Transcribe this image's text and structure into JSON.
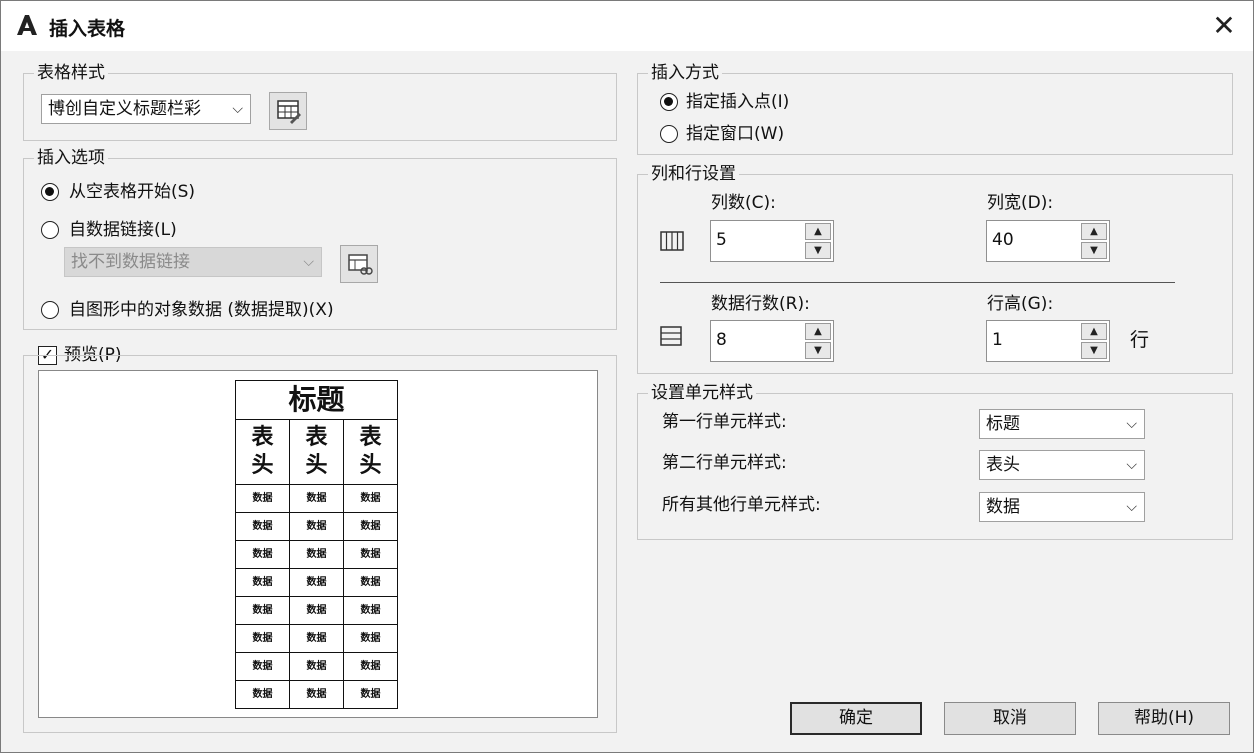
{
  "window": {
    "title": "插入表格",
    "close_glyph": "✕"
  },
  "table_style": {
    "group_label": "表格样式",
    "selected": "博创自定义标题栏彩"
  },
  "insert_options": {
    "group_label": "插入选项",
    "from_empty": "从空表格开始(S)",
    "from_data_link": "自数据链接(L)",
    "data_link_combo": "找不到数据链接",
    "from_object_data": "自图形中的对象数据 (数据提取)(X)",
    "selected": "from_empty"
  },
  "preview": {
    "label": "预览(P)",
    "checked": true,
    "title": "标题",
    "header_cell": "表\n头",
    "data_cell": "数据",
    "data_rows": 8,
    "columns": 3
  },
  "insertion_behavior": {
    "group_label": "插入方式",
    "specify_insertion_point": "指定插入点(I)",
    "specify_window": "指定窗口(W)",
    "selected": "specify_insertion_point"
  },
  "columns_rows": {
    "group_label": "列和行设置",
    "columns_label": "列数(C):",
    "columns_value": "5",
    "column_width_label": "列宽(D):",
    "column_width_value": "40",
    "data_rows_label": "数据行数(R):",
    "data_rows_value": "8",
    "row_height_label": "行高(G):",
    "row_height_value": "1",
    "row_height_unit": "行"
  },
  "cell_styles": {
    "group_label": "设置单元样式",
    "first_row_label": "第一行单元样式:",
    "first_row_value": "标题",
    "second_row_label": "第二行单元样式:",
    "second_row_value": "表头",
    "other_rows_label": "所有其他行单元样式:",
    "other_rows_value": "数据"
  },
  "buttons": {
    "ok": "确定",
    "cancel": "取消",
    "help": "帮助(H)"
  },
  "icons": {
    "app_logo": "autocad-logo-icon",
    "table_style_dialog": "table-style-dialog-icon",
    "data_link_manager": "data-link-manager-icon",
    "columns": "columns-icon",
    "rows": "rows-icon",
    "dropdown": "chevron-down-icon",
    "spinner_up": "▲",
    "spinner_down": "▼"
  }
}
